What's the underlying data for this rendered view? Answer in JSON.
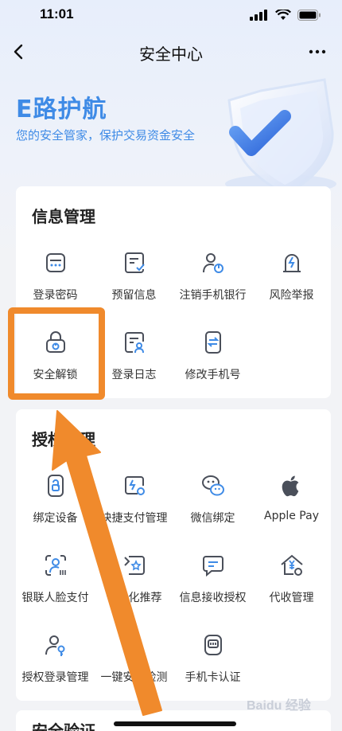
{
  "status_bar": {
    "time": "11:01"
  },
  "nav": {
    "title": "安全中心"
  },
  "hero": {
    "title": "E路护航",
    "subtitle": "您的安全管家，保护交易资金安全"
  },
  "info_section": {
    "title": "信息管理",
    "items": [
      {
        "label": "登录密码",
        "icon": "password-icon"
      },
      {
        "label": "预留信息",
        "icon": "reserved-info-icon"
      },
      {
        "label": "注销手机银行",
        "icon": "cancel-account-icon"
      },
      {
        "label": "风险举报",
        "icon": "risk-report-icon"
      },
      {
        "label": "安全解锁",
        "icon": "unlock-icon"
      },
      {
        "label": "登录日志",
        "icon": "login-log-icon"
      },
      {
        "label": "修改手机号",
        "icon": "change-phone-icon"
      }
    ]
  },
  "auth_section": {
    "title": "授权管理",
    "items": [
      {
        "label": "绑定设备",
        "icon": "bind-device-icon"
      },
      {
        "label": "快捷支付管理",
        "icon": "quick-pay-icon"
      },
      {
        "label": "微信绑定",
        "icon": "wechat-icon"
      },
      {
        "label": "Apple Pay",
        "icon": "apple-icon"
      },
      {
        "label": "银联人脸支付",
        "icon": "face-pay-icon"
      },
      {
        "label": "个性化推荐",
        "icon": "recommend-icon"
      },
      {
        "label": "信息接收授权",
        "icon": "message-auth-icon"
      },
      {
        "label": "代收管理",
        "icon": "collection-icon"
      },
      {
        "label": "授权登录管理",
        "icon": "auth-login-icon"
      },
      {
        "label": "一键安全检测",
        "icon": "security-check-icon"
      },
      {
        "label": "手机卡认证",
        "icon": "sim-card-icon"
      }
    ]
  },
  "next_section": {
    "title": "安全验证"
  },
  "watermark": "Baidu 经验",
  "colors": {
    "accent": "#3f8be6",
    "highlight": "#f08a2c",
    "icon_stroke": "#4a4f5a",
    "icon_accent": "#3f8be6"
  }
}
